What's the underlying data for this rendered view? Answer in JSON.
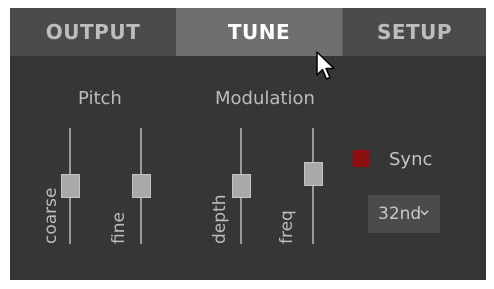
{
  "tabs": [
    {
      "label": "OUTPUT",
      "active": false
    },
    {
      "label": "TUNE",
      "active": true
    },
    {
      "label": "SETUP",
      "active": false
    }
  ],
  "sections": {
    "pitch": "Pitch",
    "modulation": "Modulation"
  },
  "sliders": [
    {
      "label": "coarse",
      "value": 0.5
    },
    {
      "label": "fine",
      "value": 0.5
    },
    {
      "label": "depth",
      "value": 0.5
    },
    {
      "label": "freq",
      "value": 0.67
    }
  ],
  "sync": {
    "label": "Sync",
    "enabled": true,
    "color": "#8b0e10",
    "rate": "32nd"
  },
  "icons": [
    "chevron-down-icon",
    "mouse-cursor-icon"
  ]
}
